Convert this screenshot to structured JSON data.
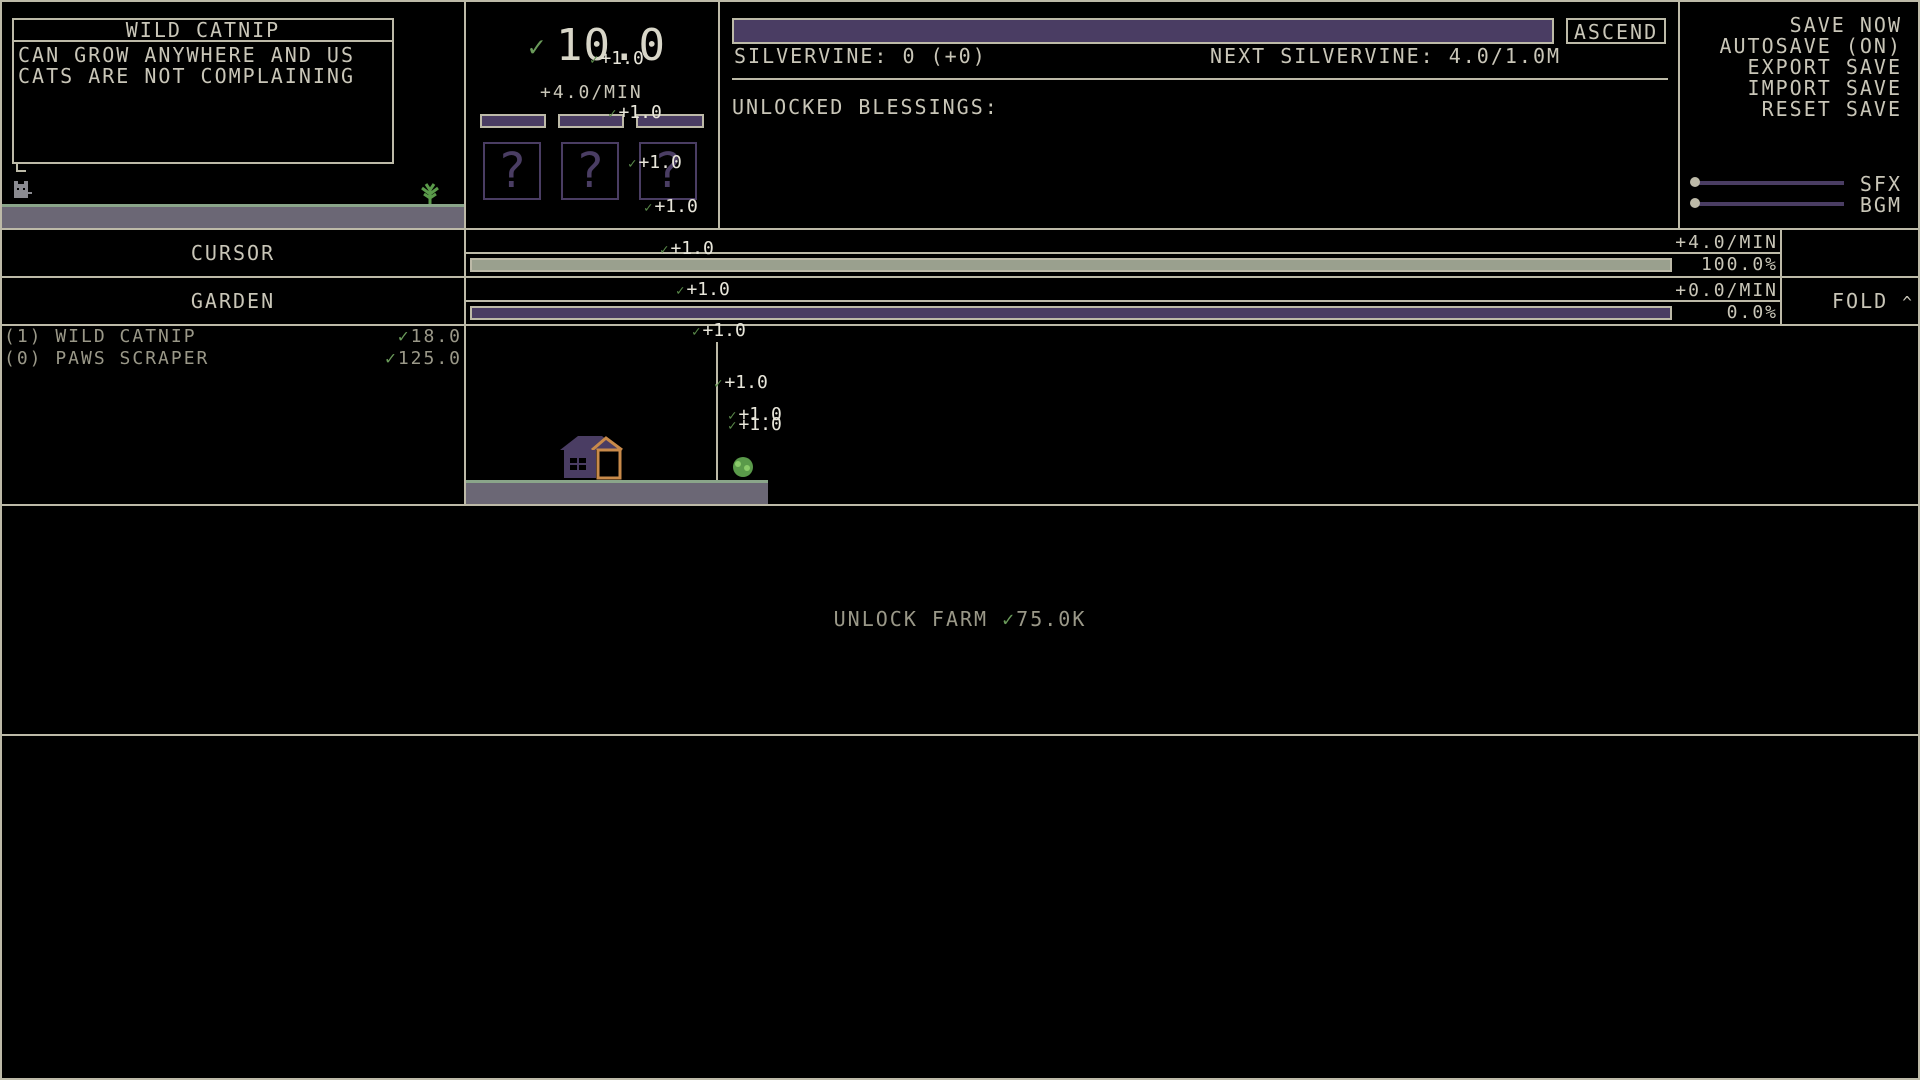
{
  "item_panel": {
    "title": "WILD CATNIP",
    "description": "CAN GROW ANYWHERE AND US CATS ARE NOT COMPLAINING"
  },
  "currency": {
    "amount": "10.0",
    "rate": "+4.0/MIN",
    "float_value": "+1.0"
  },
  "ascension": {
    "button_label": "ASCEND",
    "silvervine": "SILVERVINE: 0 (+0)",
    "next_silvervine": "NEXT SILVERVINE: 4.0/1.0M",
    "blessings_label": "UNLOCKED BLESSINGS:"
  },
  "menu": {
    "save_now": "SAVE NOW",
    "autosave": "AUTOSAVE (ON)",
    "export_save": "EXPORT SAVE",
    "import_save": "IMPORT SAVE",
    "reset_save": "RESET SAVE",
    "sfx_label": "SFX",
    "bgm_label": "BGM"
  },
  "rows": {
    "cursor": {
      "label": "CURSOR",
      "rate": "+4.0/MIN",
      "percent": "100.0%",
      "progress": 1.0
    },
    "garden": {
      "label": "GARDEN",
      "rate": "+0.0/MIN",
      "percent": "0.0%",
      "progress": 0.0,
      "fold_label": "FOLD"
    }
  },
  "shop": [
    {
      "name": "(1) WILD CATNIP",
      "price": "18.0"
    },
    {
      "name": "(0) PAWS SCRAPER",
      "price": "125.0"
    }
  ],
  "farm": {
    "unlock_label": "UNLOCK FARM",
    "price": "75.0K"
  },
  "colors": {
    "purple": "#4a3d63",
    "line": "#bdbaa8",
    "leaf": "#6a9a5a"
  }
}
